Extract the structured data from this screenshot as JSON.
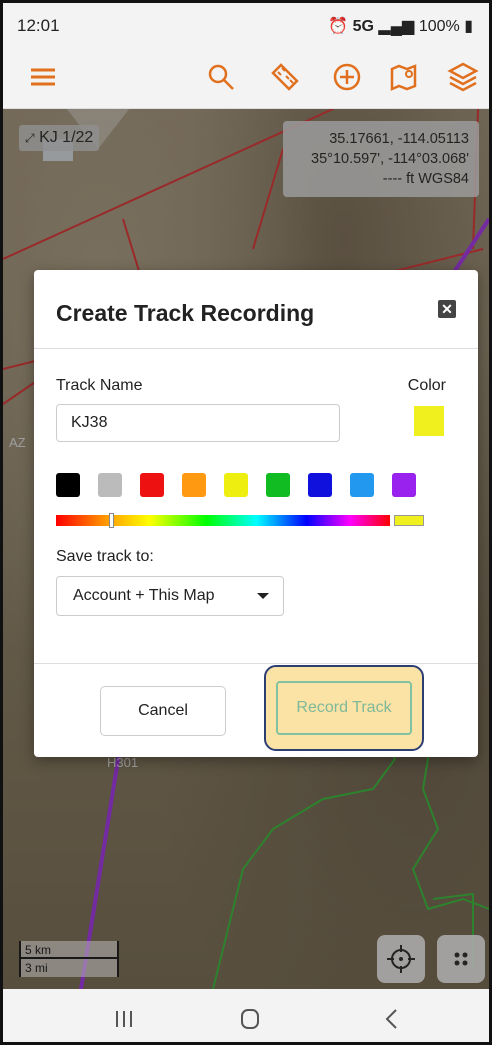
{
  "status": {
    "time": "12:01",
    "network": "5G",
    "battery": "100%"
  },
  "toolbar": {
    "icons": [
      "menu-icon",
      "search-icon",
      "ruler-icon",
      "add-icon",
      "map-marker-icon",
      "layers-icon"
    ],
    "accent": "#e0701e"
  },
  "map": {
    "map_chip": "KJ 1/22",
    "coords": {
      "decimal": "35.17661, -114.05113",
      "dms": "35°10.597', -114°03.068'",
      "elevation": "---- ft   WGS84"
    },
    "state_label": "AZ",
    "highway_label": "H301",
    "scale": {
      "km": "5 km",
      "mi": "3 mi"
    }
  },
  "dialog": {
    "title": "Create Track Recording",
    "track_name_label": "Track Name",
    "track_name_value": "KJ38",
    "color_label": "Color",
    "selected_color": "#f1f01f",
    "swatches": [
      "#000000",
      "#bbbbbb",
      "#ee1111",
      "#ff9911",
      "#eeee11",
      "#11bb22",
      "#1111dd",
      "#2299ee",
      "#9922ee"
    ],
    "spectrum_position": 0.16,
    "save_to_label": "Save track to:",
    "save_to_value": "Account + This Map",
    "cancel_label": "Cancel",
    "record_label": "Record Track"
  },
  "navbar": {
    "icons": [
      "recent-apps-icon",
      "home-icon",
      "back-icon"
    ]
  }
}
